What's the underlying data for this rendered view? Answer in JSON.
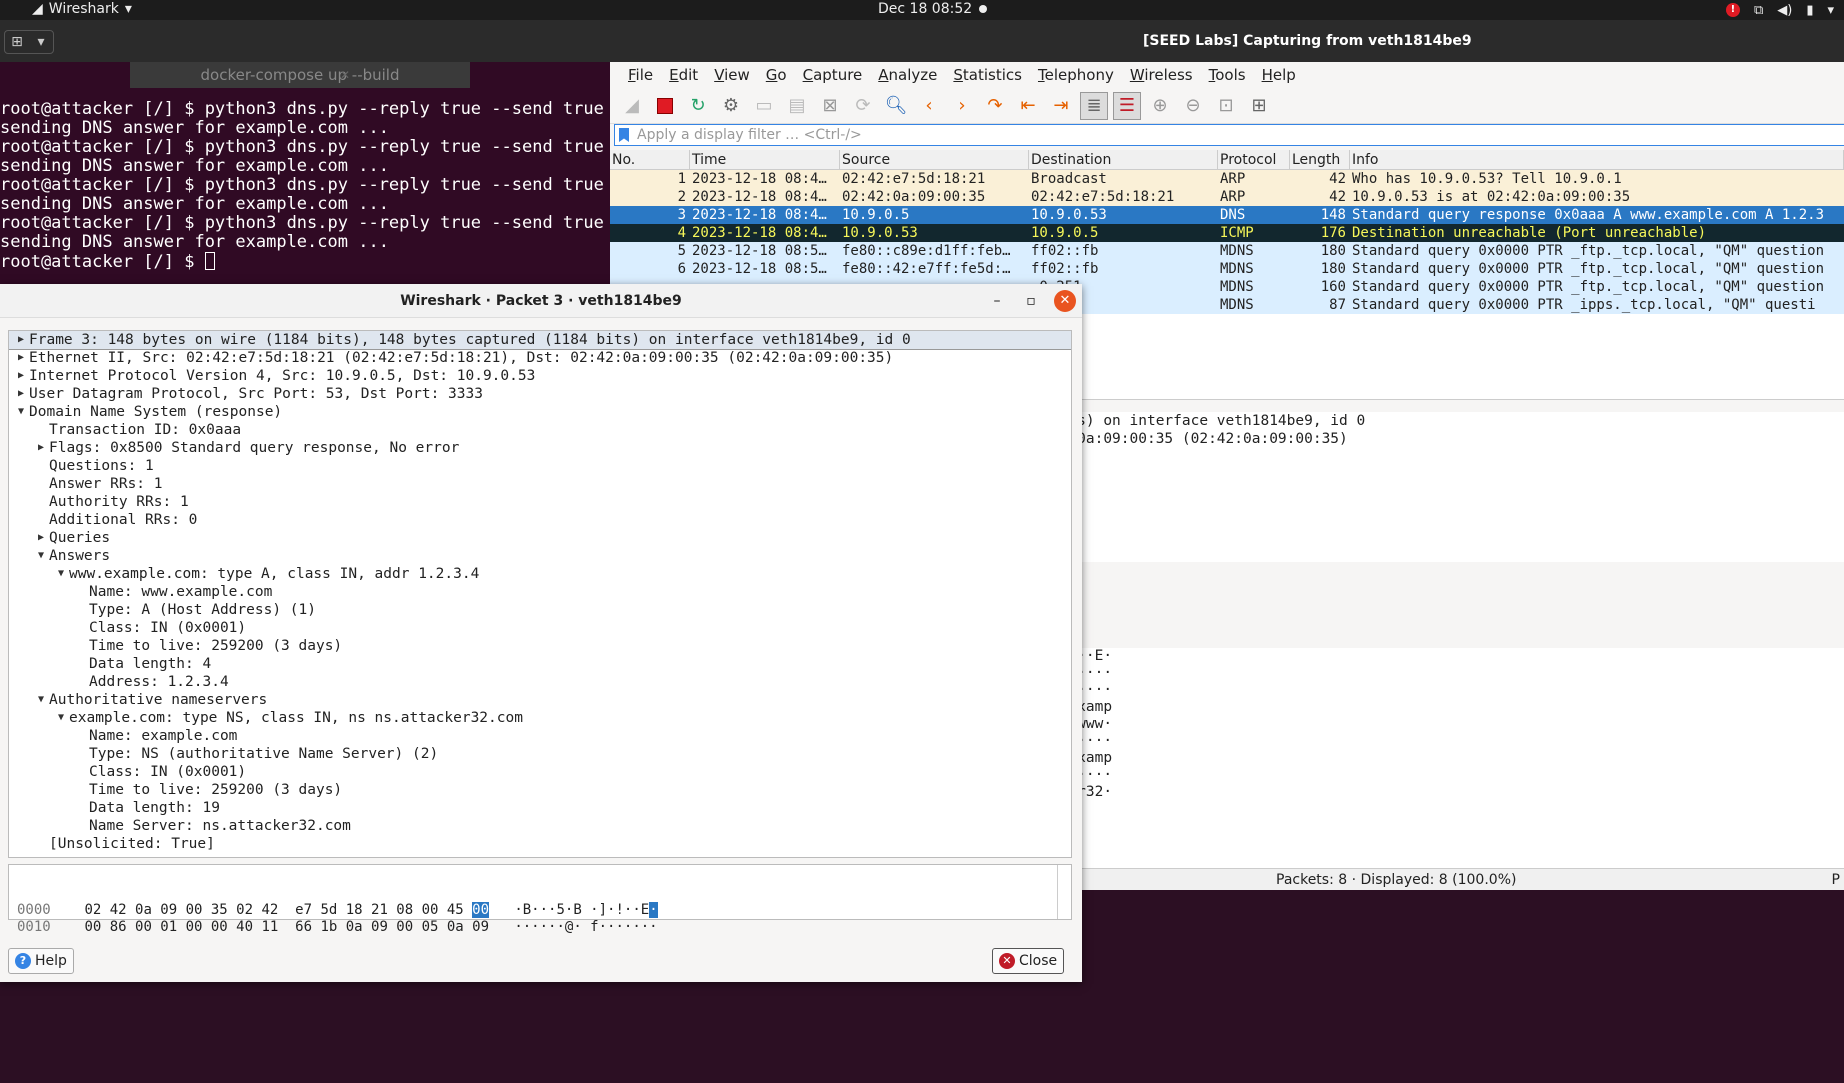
{
  "topbar": {
    "app_name": "Wireshark",
    "clock": "Dec 18  08:52"
  },
  "terminal": {
    "tab_title": "docker-compose up --build",
    "lines": [
      "root@attacker [/] $ python3 dns.py --reply true --send true",
      "sending DNS answer for example.com ...",
      "root@attacker [/] $ python3 dns.py --reply true --send true",
      "sending DNS answer for example.com ...",
      "root@attacker [/] $ python3 dns.py --reply true --send true",
      "sending DNS answer for example.com ...",
      "root@attacker [/] $ python3 dns.py --reply true --send true",
      "sending DNS answer for example.com ...",
      "root@attacker [/] $ "
    ]
  },
  "wireshark": {
    "title": "[SEED Labs] Capturing from veth1814be9",
    "menu": [
      "File",
      "Edit",
      "View",
      "Go",
      "Capture",
      "Analyze",
      "Statistics",
      "Telephony",
      "Wireless",
      "Tools",
      "Help"
    ],
    "filter_placeholder": "Apply a display filter … <Ctrl-/>",
    "columns": [
      "No.",
      "Time",
      "Source",
      "Destination",
      "Protocol",
      "Length",
      "Info"
    ],
    "packets": [
      {
        "no": "1",
        "time": "2023-12-18 08:4…",
        "src": "02:42:e7:5d:18:21",
        "dst": "Broadcast",
        "proto": "ARP",
        "len": "42",
        "info": "Who has 10.9.0.53? Tell 10.9.0.1"
      },
      {
        "no": "2",
        "time": "2023-12-18 08:4…",
        "src": "02:42:0a:09:00:35",
        "dst": "02:42:e7:5d:18:21",
        "proto": "ARP",
        "len": "42",
        "info": "10.9.0.53 is at 02:42:0a:09:00:35"
      },
      {
        "no": "3",
        "time": "2023-12-18 08:4…",
        "src": "10.9.0.5",
        "dst": "10.9.0.53",
        "proto": "DNS",
        "len": "148",
        "info": "Standard query response 0x0aaa A www.example.com A 1.2.3"
      },
      {
        "no": "4",
        "time": "2023-12-18 08:4…",
        "src": "10.9.0.53",
        "dst": "10.9.0.5",
        "proto": "ICMP",
        "len": "176",
        "info": "Destination unreachable (Port unreachable)"
      },
      {
        "no": "5",
        "time": "2023-12-18 08:5…",
        "src": "fe80::c89e:d1ff:feb…",
        "dst": "ff02::fb",
        "proto": "MDNS",
        "len": "180",
        "info": "Standard query 0x0000 PTR _ftp._tcp.local, \"QM\" question"
      },
      {
        "no": "6",
        "time": "2023-12-18 08:5…",
        "src": "fe80::42:e7ff:fe5d:…",
        "dst": "ff02::fb",
        "proto": "MDNS",
        "len": "180",
        "info": "Standard query 0x0000 PTR _ftp._tcp.local, \"QM\" question"
      },
      {
        "no": "",
        "time": "",
        "src": "",
        "dst": ".0.251",
        "proto": "MDNS",
        "len": "160",
        "info": "Standard query 0x0000 PTR _ftp._tcp.local, \"QM\" question"
      },
      {
        "no": "",
        "time": "",
        "src": "",
        "dst": ".0.251",
        "proto": "MDNS",
        "len": "87",
        "info": "Standard query 0x0000 PTR _ipps._tcp.local, \"QM\" questi"
      }
    ],
    "detail_lines": [
      "captured (1184 bits) on interface veth1814be9, id 0",
      "8:21), Dst: 02:42:0a:09:00:35 (02:42:0a:09:00:35)",
      "0.9.0.53",
      "33"
    ],
    "bytes_lines": [
      "00   ·B···5·B ·]·!··E·",
      "09   ······@· f·······",
      "01   ·5·5···r ········",
      "70   ·······w ww·examp",
      "07   le·com·· ····www·",
      "01   example· com·····",
      "70   ········ ···examp",
      "00   le·com·· ········",
      "03   ··ns·att acker32·",
      "     com·"
    ],
    "status_text": "Packets: 8 · Displayed: 8 (100.0%)",
    "status_right": "P"
  },
  "dialog": {
    "title": "Wireshark · Packet 3 · veth1814be9",
    "tree": [
      {
        "indent": 0,
        "arrow": "right",
        "text": "Frame 3: 148 bytes on wire (1184 bits), 148 bytes captured (1184 bits) on interface veth1814be9, id 0"
      },
      {
        "indent": 0,
        "arrow": "right",
        "text": "Ethernet II, Src: 02:42:e7:5d:18:21 (02:42:e7:5d:18:21), Dst: 02:42:0a:09:00:35 (02:42:0a:09:00:35)"
      },
      {
        "indent": 0,
        "arrow": "right",
        "text": "Internet Protocol Version 4, Src: 10.9.0.5, Dst: 10.9.0.53"
      },
      {
        "indent": 0,
        "arrow": "right",
        "text": "User Datagram Protocol, Src Port: 53, Dst Port: 3333"
      },
      {
        "indent": 0,
        "arrow": "down",
        "text": "Domain Name System (response)"
      },
      {
        "indent": 1,
        "arrow": "",
        "text": "Transaction ID: 0x0aaa"
      },
      {
        "indent": 1,
        "arrow": "right",
        "text": "Flags: 0x8500 Standard query response, No error"
      },
      {
        "indent": 1,
        "arrow": "",
        "text": "Questions: 1"
      },
      {
        "indent": 1,
        "arrow": "",
        "text": "Answer RRs: 1"
      },
      {
        "indent": 1,
        "arrow": "",
        "text": "Authority RRs: 1"
      },
      {
        "indent": 1,
        "arrow": "",
        "text": "Additional RRs: 0"
      },
      {
        "indent": 1,
        "arrow": "right",
        "text": "Queries"
      },
      {
        "indent": 1,
        "arrow": "down",
        "text": "Answers"
      },
      {
        "indent": 2,
        "arrow": "down",
        "text": "www.example.com: type A, class IN, addr 1.2.3.4"
      },
      {
        "indent": 3,
        "arrow": "",
        "text": "Name: www.example.com"
      },
      {
        "indent": 3,
        "arrow": "",
        "text": "Type: A (Host Address) (1)"
      },
      {
        "indent": 3,
        "arrow": "",
        "text": "Class: IN (0x0001)"
      },
      {
        "indent": 3,
        "arrow": "",
        "text": "Time to live: 259200 (3 days)"
      },
      {
        "indent": 3,
        "arrow": "",
        "text": "Data length: 4"
      },
      {
        "indent": 3,
        "arrow": "",
        "text": "Address: 1.2.3.4"
      },
      {
        "indent": 1,
        "arrow": "down",
        "text": "Authoritative nameservers"
      },
      {
        "indent": 2,
        "arrow": "down",
        "text": "example.com: type NS, class IN, ns ns.attacker32.com"
      },
      {
        "indent": 3,
        "arrow": "",
        "text": "Name: example.com"
      },
      {
        "indent": 3,
        "arrow": "",
        "text": "Type: NS (authoritative Name Server) (2)"
      },
      {
        "indent": 3,
        "arrow": "",
        "text": "Class: IN (0x0001)"
      },
      {
        "indent": 3,
        "arrow": "",
        "text": "Time to live: 259200 (3 days)"
      },
      {
        "indent": 3,
        "arrow": "",
        "text": "Data length: 19"
      },
      {
        "indent": 3,
        "arrow": "",
        "text": "Name Server: ns.attacker32.com"
      },
      {
        "indent": 1,
        "arrow": "",
        "text": "[Unsolicited: True]"
      }
    ],
    "hex_rows": [
      {
        "offset": "0000",
        "hex": "02 42 0a 09 00 35 02 42  e7 5d 18 21 08 00 45 ",
        "hex_hl": "00",
        "ascii": "·B···5·B ·]·!··E",
        "ascii_hl": "·"
      },
      {
        "offset": "0010",
        "hex": "00 86 00 01 00 00 40 11  66 1b 0a 09 00 05 0a 09",
        "hex_hl": "",
        "ascii": "······@· f·······",
        "ascii_hl": ""
      }
    ],
    "help_label": "Help",
    "close_label": "Close"
  }
}
